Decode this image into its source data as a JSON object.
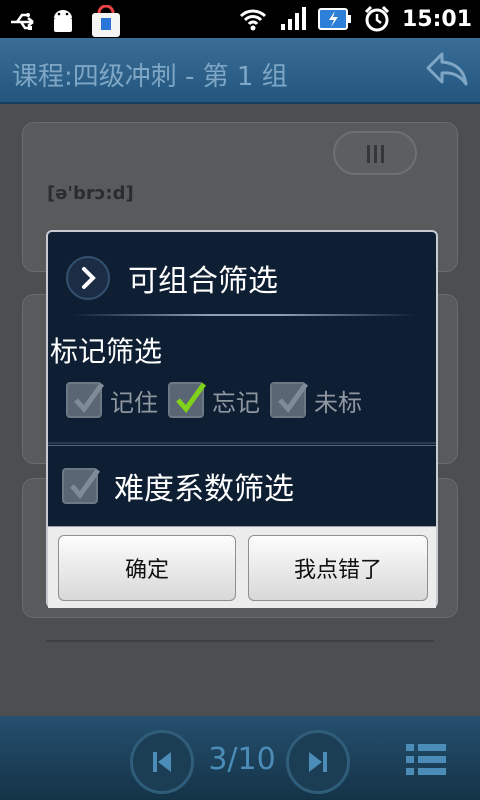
{
  "status_bar": {
    "time": "15:01",
    "icons": [
      "usb-icon",
      "android-debug-icon",
      "app-store-icon",
      "wifi-icon",
      "signal-icon",
      "battery-charging-icon",
      "alarm-icon"
    ]
  },
  "header": {
    "title": "课程:四级冲刺 - 第 1 组",
    "back_icon": "reply-back-icon"
  },
  "card": {
    "phonetic": "[ə'brɔ:d]"
  },
  "dialog": {
    "title": "可组合筛选",
    "mark_section_label": "标记筛选",
    "checkboxes": [
      {
        "label": "记住",
        "checked": false
      },
      {
        "label": "忘记",
        "checked": true
      },
      {
        "label": "未标",
        "checked": false
      }
    ],
    "difficulty_label": "难度系数筛选",
    "difficulty_checked": false,
    "ok_button": "确定",
    "cancel_button": "我点错了"
  },
  "bottom_bar": {
    "page_indicator": "3/10"
  },
  "colors": {
    "accent_blue": "#2a5c84",
    "check_green": "#7fd11a",
    "dialog_bg": "#0f1f33"
  }
}
